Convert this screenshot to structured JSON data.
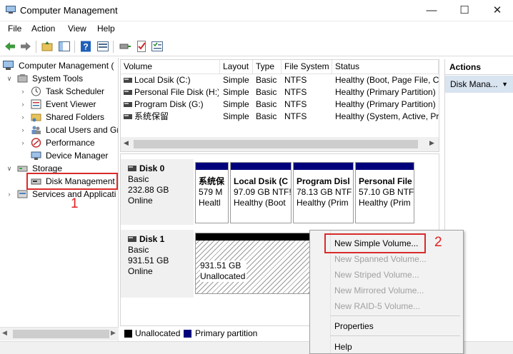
{
  "window": {
    "title": "Computer Management"
  },
  "menu": [
    "File",
    "Action",
    "View",
    "Help"
  ],
  "tree": {
    "root": "Computer Management (",
    "system_tools": "System Tools",
    "task_scheduler": "Task Scheduler",
    "event_viewer": "Event Viewer",
    "shared_folders": "Shared Folders",
    "local_users": "Local Users and Gr",
    "performance": "Performance",
    "device_manager": "Device Manager",
    "storage": "Storage",
    "disk_management": "Disk Management",
    "services": "Services and Applicati"
  },
  "volumes": {
    "columns": [
      "Volume",
      "Layout",
      "Type",
      "File System",
      "Status"
    ],
    "rows": [
      {
        "volume": "Local Dsik (C:)",
        "layout": "Simple",
        "type": "Basic",
        "fs": "NTFS",
        "status": "Healthy (Boot, Page File, Cra"
      },
      {
        "volume": "Personal File Disk (H:)",
        "layout": "Simple",
        "type": "Basic",
        "fs": "NTFS",
        "status": "Healthy (Primary Partition)"
      },
      {
        "volume": "Program Disk  (G:)",
        "layout": "Simple",
        "type": "Basic",
        "fs": "NTFS",
        "status": "Healthy (Primary Partition)"
      },
      {
        "volume": "系统保留",
        "layout": "Simple",
        "type": "Basic",
        "fs": "NTFS",
        "status": "Healthy (System, Active, Pri"
      }
    ]
  },
  "disks": [
    {
      "name": "Disk 0",
      "type": "Basic",
      "size": "232.88 GB",
      "state": "Online",
      "partitions": [
        {
          "name": "系统保",
          "size": "579 M",
          "status": "Healtl"
        },
        {
          "name": "Local Dsik  (C",
          "size": "97.09 GB NTF!",
          "status": "Healthy (Boot"
        },
        {
          "name": "Program Disl",
          "size": "78.13 GB NTF",
          "status": "Healthy (Prim"
        },
        {
          "name": "Personal File",
          "size": "57.10 GB NTF",
          "status": "Healthy (Prim"
        }
      ]
    },
    {
      "name": "Disk 1",
      "type": "Basic",
      "size": "931.51 GB",
      "state": "Online",
      "unallocated": {
        "size": "931.51 GB",
        "label": "Unallocated"
      }
    }
  ],
  "legend": {
    "unallocated": "Unallocated",
    "primary": "Primary partition"
  },
  "actions": {
    "header": "Actions",
    "item": "Disk Mana..."
  },
  "context_menu": {
    "new_simple": "New Simple Volume...",
    "new_spanned": "New Spanned Volume...",
    "new_striped": "New Striped Volume...",
    "new_mirrored": "New Mirrored Volume...",
    "new_raid5": "New RAID-5 Volume...",
    "properties": "Properties",
    "help": "Help"
  },
  "callouts": {
    "one": "1",
    "two": "2"
  },
  "colors": {
    "primary": "#00007b",
    "highlight": "#d92b2b",
    "actions_item_bg": "#d9e4f1"
  }
}
